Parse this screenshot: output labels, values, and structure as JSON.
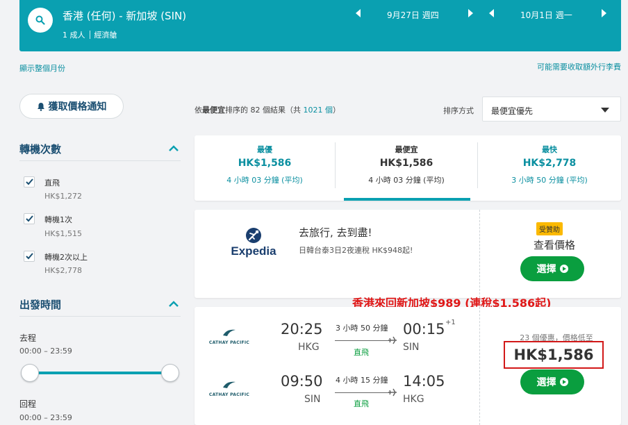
{
  "search": {
    "route": "香港 (任何) - 新加坡 (SIN)",
    "passengers": "1 成人",
    "cabin": "經濟艙",
    "depart_date": "9月27日 週四",
    "return_date": "10月1日 週一"
  },
  "links": {
    "show_month": "顯示整個月份",
    "baggage_fees": "可能需要收取額外行李費"
  },
  "sidebar": {
    "price_alert": "獲取價格通知",
    "stops_title": "轉機次數",
    "stops": [
      {
        "label": "直飛",
        "price": "HK$1,272"
      },
      {
        "label": "轉機1次",
        "price": "HK$1,515"
      },
      {
        "label": "轉機2次以上",
        "price": "HK$2,778"
      }
    ],
    "times_title": "出發時間",
    "outbound_label": "去程",
    "outbound_range": "00:00 – 23:59",
    "return_label": "回程",
    "return_range": "00:00 – 23:59"
  },
  "sort": {
    "summary_pre": "依",
    "summary_key": "最便宜",
    "summary_mid": "排序的 82 個結果（共 ",
    "summary_total": "1021 個",
    "summary_post": "）",
    "label": "排序方式",
    "selected": "最便宜優先"
  },
  "tabs": [
    {
      "title": "最優",
      "price": "HK$1,586",
      "duration": "4 小時 03 分鐘 (平均)"
    },
    {
      "title": "最便宜",
      "price": "HK$1,586",
      "duration": "4 小時 03 分鐘 (平均)"
    },
    {
      "title": "最快",
      "price": "HK$2,778",
      "duration": "3 小時 50 分鐘 (平均)"
    }
  ],
  "ad": {
    "brand": "Expedia",
    "title": "去旅行, 去到盡!",
    "subtitle": "日韓台泰3日2夜連稅 HK$948起!",
    "sponsored": "受贊助",
    "cta": "查看價格",
    "select": "選擇"
  },
  "promo_text": "香港來回新加坡$989 (連稅$1,586起)",
  "result": {
    "airline": "CATHAY PACIFIC",
    "deals": "23 個優惠，價格低至",
    "price": "HK$1,586",
    "select": "選擇",
    "legs": [
      {
        "dep_time": "20:25",
        "dep_code": "HKG",
        "duration": "3 小時 50 分鐘",
        "stops": "直飛",
        "arr_time": "00:15",
        "arr_code": "SIN",
        "day_offset": "+1"
      },
      {
        "dep_time": "09:50",
        "dep_code": "SIN",
        "duration": "4 小時 15 分鐘",
        "stops": "直飛",
        "arr_time": "14:05",
        "arr_code": "HKG",
        "day_offset": ""
      }
    ]
  },
  "colors": {
    "brand_teal": "#0aa0b1",
    "select_green": "#0a9e3f",
    "promo_red": "#e01818"
  }
}
